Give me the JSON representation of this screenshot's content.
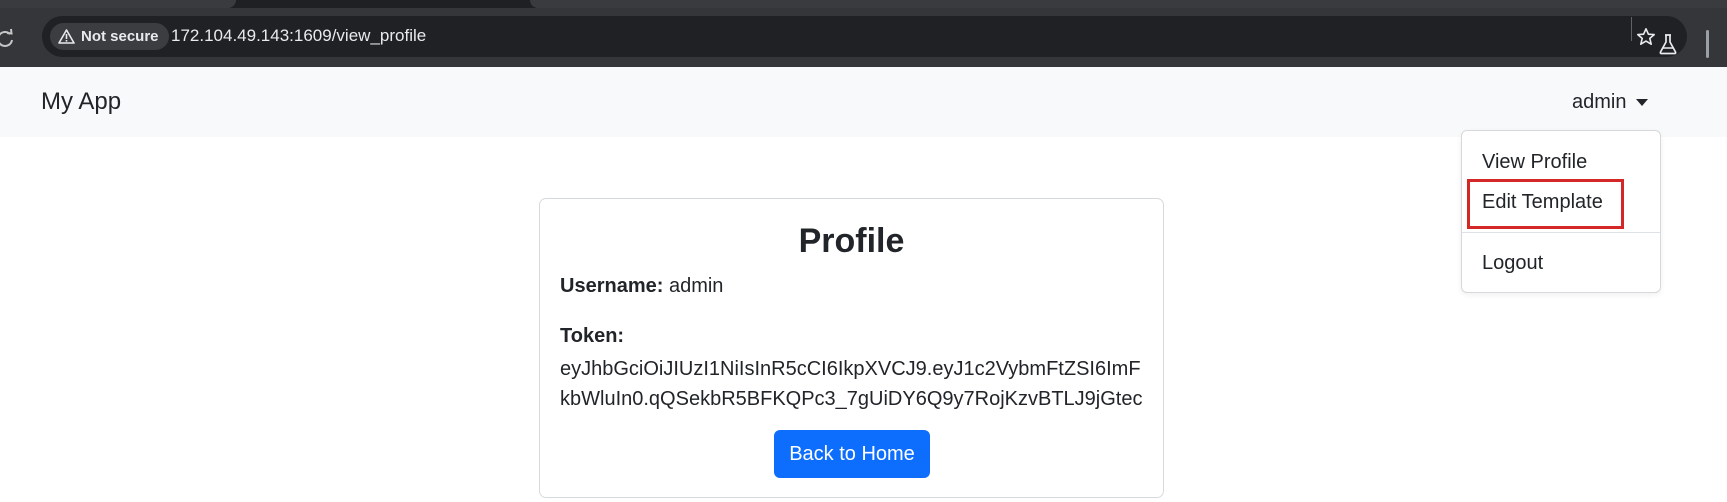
{
  "browser": {
    "security_label": "Not secure",
    "url": "172.104.49.143:1609/view_profile"
  },
  "navbar": {
    "brand": "My App",
    "user": "admin"
  },
  "dropdown": {
    "items": [
      "View Profile",
      "Edit Template",
      "Logout"
    ],
    "highlighted_item": "Edit Template",
    "highlight_color": "#d42727"
  },
  "profile": {
    "title": "Profile",
    "username_label": "Username:",
    "username_value": "admin",
    "token_label": "Token:",
    "token_value": "eyJhbGciOiJIUzI1NiIsInR5cCI6IkpXVCJ9.eyJ1c2VybmFtZSI6ImFkbWluIn0.qQSekbR5BFKQPc3_7gUiDY6Q9y7RojKzvBTLJ9jGtec",
    "back_button": "Back to Home"
  },
  "colors": {
    "primary": "#0d6efd",
    "navbar_bg": "#f8f9fa",
    "chrome_bg": "#35363a"
  }
}
